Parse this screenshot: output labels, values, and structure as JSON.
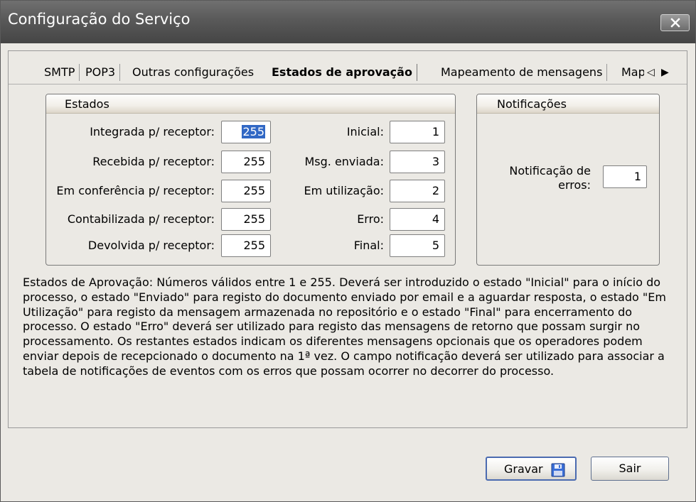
{
  "window": {
    "title": "Configuração do Serviço"
  },
  "tabs": [
    {
      "label": "SMTP"
    },
    {
      "label": "POP3"
    },
    {
      "label": "Outras configurações"
    },
    {
      "label": "Estados de aprovação",
      "active": true
    },
    {
      "label": "Mapeamento de mensagens"
    },
    {
      "label": "Map"
    }
  ],
  "estados": {
    "title": "Estados",
    "left_fields": [
      {
        "label": "Integrada p/ receptor:",
        "value": "255",
        "selected": true
      },
      {
        "label": "Recebida p/ receptor:",
        "value": "255"
      },
      {
        "label": "Em conferência p/ receptor:",
        "value": "255"
      },
      {
        "label": "Contabilizada p/ receptor:",
        "value": "255"
      },
      {
        "label": "Devolvida p/ receptor:",
        "value": "255"
      }
    ],
    "right_fields": [
      {
        "label": "Inicial:",
        "value": "1"
      },
      {
        "label": "Msg. enviada:",
        "value": "3"
      },
      {
        "label": "Em utilização:",
        "value": "2"
      },
      {
        "label": "Erro:",
        "value": "4"
      },
      {
        "label": "Final:",
        "value": "5"
      }
    ]
  },
  "notificacoes": {
    "title": "Notificações",
    "label_line1": "Notificação de",
    "label_line2": "erros:",
    "value": "1"
  },
  "description": "Estados de Aprovação: Números válidos entre 1 e 255. Deverá ser introduzido o estado \"Inicial\" para o início do processo, o estado \"Enviado\" para registo do documento enviado por email e a aguardar resposta, o estado \"Em Utilização\" para registo da mensagem armazenada no repositório e o estado \"Final\" para encerramento do processo. O estado \"Erro\" deverá ser utilizado para registo das mensagens de retorno que possam surgir no processamento. Os restantes estados indicam os diferentes mensagens opcionais que os operadores podem enviar depois de recepcionado o documento na 1ª vez. O campo notificação deverá ser utilizado para associar a tabela de notificações de eventos com os erros que possam ocorrer no decorrer do processo.",
  "buttons": {
    "save": "Gravar",
    "exit": "Sair"
  },
  "colors": {
    "titlebar": "#595959",
    "window_bg": "#ebe9e4",
    "selection": "#3168c5",
    "default_button_border": "#4b6bb0"
  }
}
